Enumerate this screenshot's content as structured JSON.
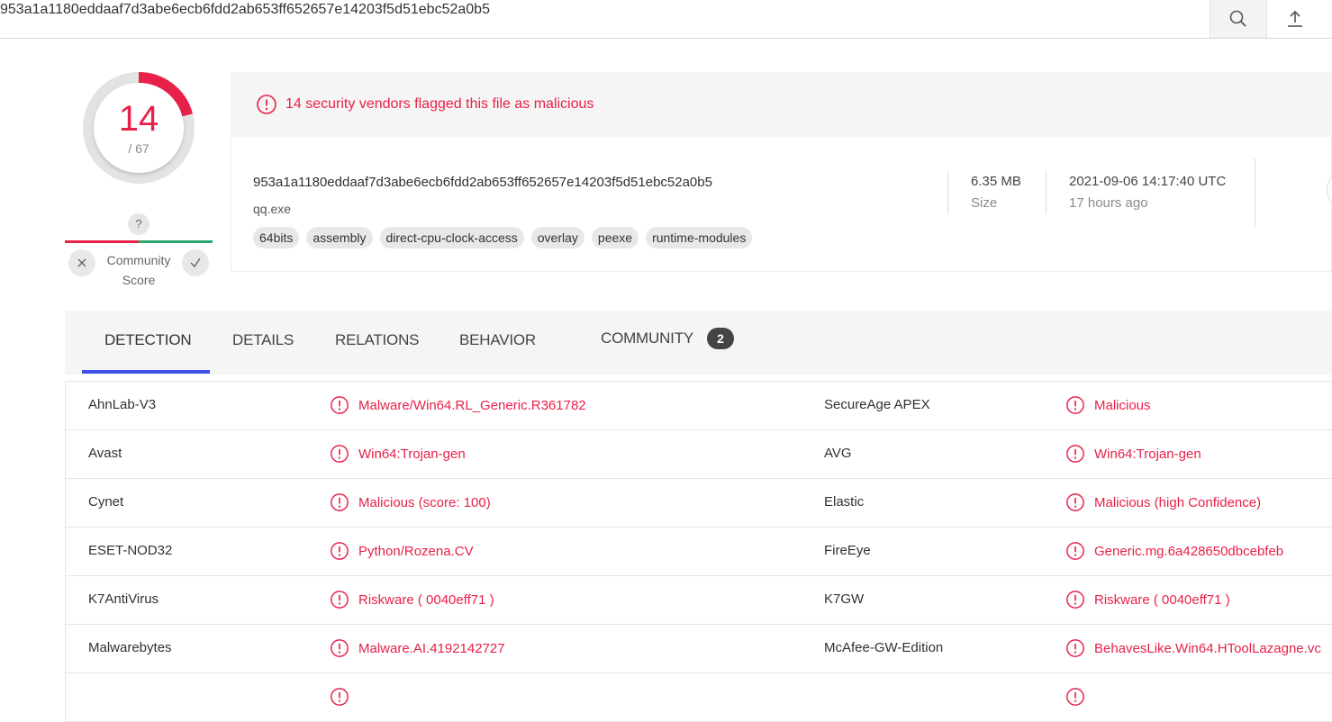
{
  "search": {
    "query": "953a1a1180eddaaf7d3abe6ecb6fdd2ab653ff652657e14203f5d51ebc52a0b5"
  },
  "score": {
    "detections": "14",
    "total": "/ 67",
    "color": "#e8214a",
    "ratio": 0.209
  },
  "community": {
    "question": "?",
    "label_line1": "Community",
    "label_line2": "Score"
  },
  "banner": {
    "text": "14 security vendors flagged this file as malicious"
  },
  "file": {
    "hash": "953a1a1180eddaaf7d3abe6ecb6fdd2ab653ff652657e14203f5d51ebc52a0b5",
    "name": "qq.exe",
    "tags": [
      "64bits",
      "assembly",
      "direct-cpu-clock-access",
      "overlay",
      "peexe",
      "runtime-modules"
    ],
    "size_value": "6.35 MB",
    "size_label": "Size",
    "date": "2021-09-06 14:17:40 UTC",
    "date_relative": "17 hours ago"
  },
  "tabs": {
    "detection": "DETECTION",
    "details": "DETAILS",
    "relations": "RELATIONS",
    "behavior": "BEHAVIOR",
    "community": "COMMUNITY",
    "community_count": "2",
    "accent": "#3f51ea"
  },
  "detections": [
    {
      "vendor1": "AhnLab-V3",
      "result1": "Malware/Win64.RL_Generic.R361782",
      "vendor2": "SecureAge APEX",
      "result2": "Malicious"
    },
    {
      "vendor1": "Avast",
      "result1": "Win64:Trojan-gen",
      "vendor2": "AVG",
      "result2": "Win64:Trojan-gen"
    },
    {
      "vendor1": "Cynet",
      "result1": "Malicious (score: 100)",
      "vendor2": "Elastic",
      "result2": "Malicious (high Confidence)"
    },
    {
      "vendor1": "ESET-NOD32",
      "result1": "Python/Rozena.CV",
      "vendor2": "FireEye",
      "result2": "Generic.mg.6a428650dbcebfeb"
    },
    {
      "vendor1": "K7AntiVirus",
      "result1": "Riskware ( 0040eff71 )",
      "vendor2": "K7GW",
      "result2": "Riskware ( 0040eff71 )"
    },
    {
      "vendor1": "Malwarebytes",
      "result1": "Malware.AI.4192142727",
      "vendor2": "McAfee-GW-Edition",
      "result2": "BehavesLike.Win64.HToolLazagne.vc"
    },
    {
      "vendor1": "",
      "result1": "",
      "vendor2": "",
      "result2": ""
    }
  ]
}
